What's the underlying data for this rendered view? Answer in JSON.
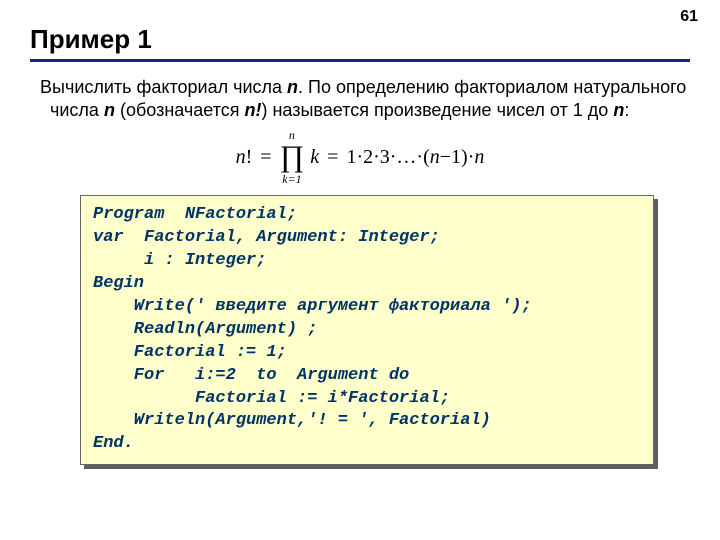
{
  "page_number": "61",
  "title": "Пример 1",
  "body_parts": {
    "p1": "Вычислить факториал числа ",
    "n1": "n",
    "p2": ". По определению факториалом натурального числа ",
    "n2": "n",
    "p3": " (обозначается ",
    "n3": "n!",
    "p4": ") называется произведение чисел от 1 до ",
    "n4": "n",
    "p5": ":"
  },
  "formula": {
    "lhs_n": "n",
    "lhs_bang": "!",
    "eq1": "=",
    "prod_top": "n",
    "prod_sym": "∏",
    "prod_bottom": "k=1",
    "k": "k",
    "eq2": "=",
    "rhs_1": "1·2·3·…·(",
    "rhs_nm1_n": "n",
    "rhs_nm1_rest": "−1)·",
    "rhs_n": "n"
  },
  "code": "Program  NFactorial;\nvar  Factorial, Argument: Integer;\n     i : Integer;\nBegin\n    Write(' введите аргумент факториала ');\n    Readln(Argument) ;\n    Factorial := 1;\n    For   i:=2  to  Argument do\n          Factorial := i*Factorial;\n    Writeln(Argument,'! = ', Factorial)\nEnd."
}
